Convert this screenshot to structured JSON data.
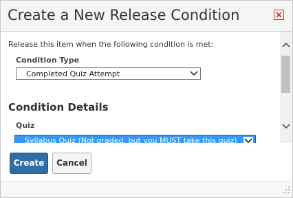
{
  "dialog": {
    "title": "Create a New Release Condition",
    "close_icon": "close-x-icon"
  },
  "body": {
    "intro": "Release this item when the following condition is met:",
    "condition_type": {
      "label": "Condition Type",
      "selected": "Completed Quiz Attempt"
    },
    "section_heading": "Condition Details",
    "quiz": {
      "label": "Quiz",
      "selected": "Syllabus Quiz (Not graded, but you MUST take this quiz)"
    }
  },
  "footer": {
    "create_label": "Create",
    "cancel_label": "Cancel"
  },
  "colors": {
    "primary": "#2f6ea6",
    "close": "#c0392b",
    "selection": "#3399ff"
  },
  "icons": [
    "close-x-icon",
    "chevron-down-icon",
    "scroll-up-arrow-icon",
    "scroll-down-arrow-icon",
    "resize-grip-icon"
  ]
}
